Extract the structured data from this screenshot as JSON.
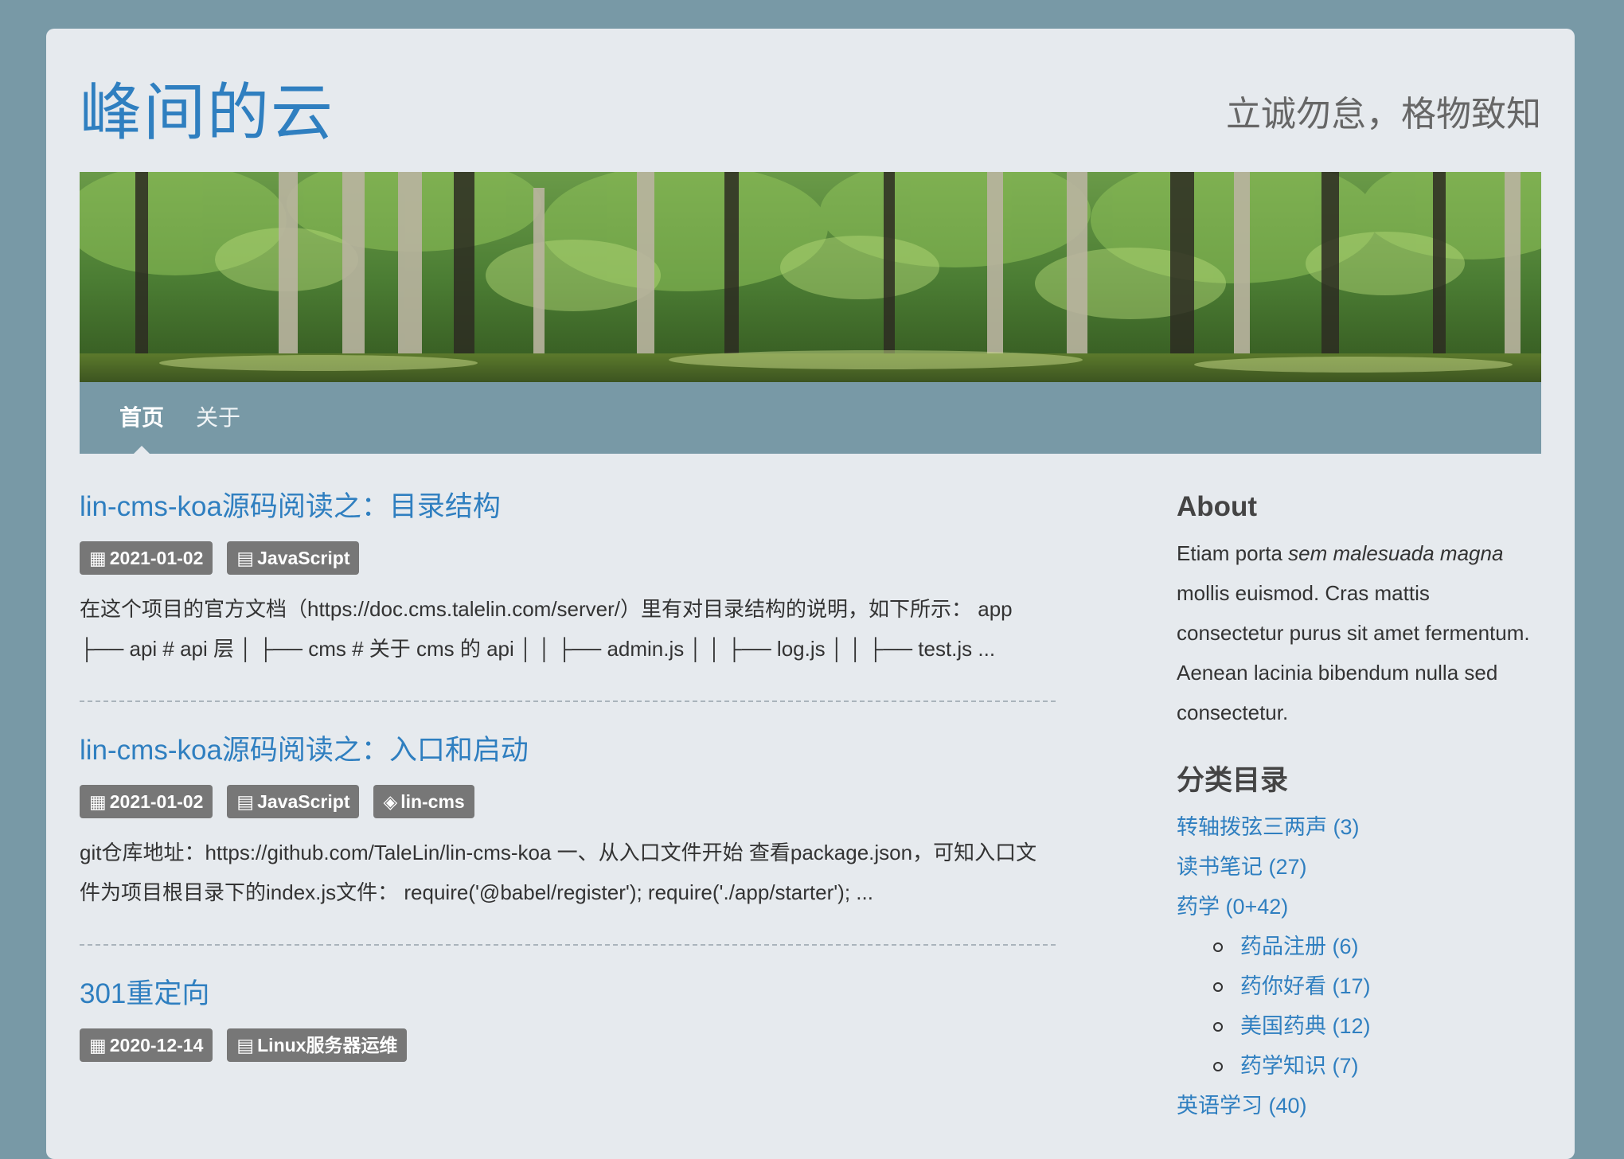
{
  "site": {
    "title": "峰间的云",
    "tagline": "立诚勿怠，格物致知"
  },
  "nav": {
    "items": [
      {
        "label": "首页",
        "active": true
      },
      {
        "label": "关于",
        "active": false
      }
    ]
  },
  "posts": [
    {
      "title": "lin-cms-koa源码阅读之：目录结构",
      "date": "2021-01-02",
      "category": "JavaScript",
      "tag": "",
      "excerpt": "在这个项目的官方文档（https://doc.cms.talelin.com/server/）里有对目录结构的说明，如下所示： app ├── api # api 层 │ ├── cms # 关于 cms 的 api │ │ ├── admin.js │ │ ├── log.js │ │ ├── test.js ..."
    },
    {
      "title": "lin-cms-koa源码阅读之：入口和启动",
      "date": "2021-01-02",
      "category": "JavaScript",
      "tag": "lin-cms",
      "excerpt": "git仓库地址：https://github.com/TaleLin/lin-cms-koa 一、从入口文件开始 查看package.json，可知入口文件为项目根目录下的index.js文件： require('@babel/register'); require('./app/starter'); ..."
    },
    {
      "title": "301重定向",
      "date": "2020-12-14",
      "category": "Linux服务器运维",
      "tag": "",
      "excerpt": ""
    }
  ],
  "icons": {
    "date": "calendar-icon",
    "category": "list-icon",
    "tag": "tag-icon"
  },
  "sidebar": {
    "about_heading": "About",
    "about_text_1": "Etiam porta ",
    "about_text_em": "sem malesuada magna",
    "about_text_2": " mollis euismod. Cras mattis consectetur purus sit amet fermentum. Aenean lacinia bibendum nulla sed consectetur.",
    "categories_heading": "分类目录",
    "categories": [
      {
        "label": "转轴拨弦三两声 (3)"
      },
      {
        "label": "读书笔记 (27)"
      },
      {
        "label": "药学 (0+42)"
      }
    ],
    "subcategories": [
      {
        "label": "药品注册 (6)"
      },
      {
        "label": "药你好看 (17)"
      },
      {
        "label": "美国药典 (12)"
      },
      {
        "label": "药学知识 (7)"
      }
    ],
    "next_category": "英语学习 (40)"
  },
  "colors": {
    "page_bg": "#7899a6",
    "container_bg": "#e6eaee",
    "link": "#2f7fc0",
    "badge": "#777777"
  }
}
